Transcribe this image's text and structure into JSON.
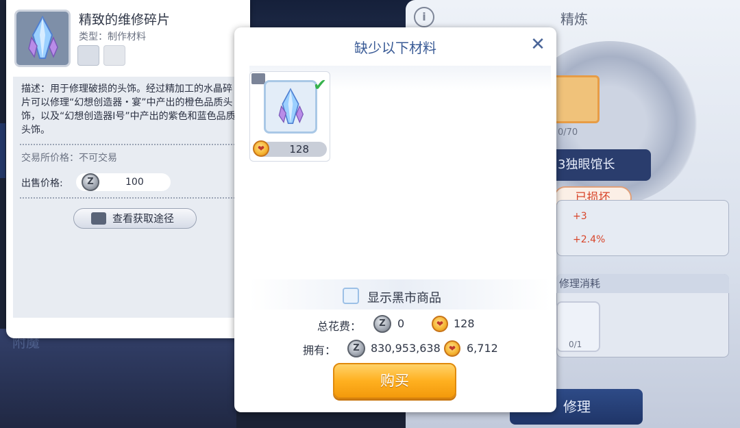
{
  "background": {
    "refine_title": "精炼",
    "info_icon": "info-icon",
    "card_count": "0/70",
    "boss_name": "3独眼馆长",
    "broken_status": "已损坏",
    "stat_line_1": "+3",
    "stat_line_2": "+2.4%",
    "repair_cost_title": "修理消耗",
    "repair_cost_count": "0/1",
    "repair_button": "修理",
    "left_menu_item": "附魔"
  },
  "tooltip": {
    "item_name": "精致的维修碎片",
    "item_type": "类型：制作材料",
    "description": "描述：用于修理破损的头饰。经过精加工的水晶碎片可以修理“幻想创造器・宴”中产出的橙色品质头饰，以及“幻想创造器I号”中产出的紫色和蓝色品质头饰。",
    "trade_price": "交易所价格：不可交易",
    "sell_price_label": "出售价格:",
    "sell_price_value": "100",
    "source_button": "查看获取途径"
  },
  "dialog": {
    "title": "缺少以下材料",
    "close_icon": "close-icon",
    "material": {
      "count": "128",
      "checked": true
    },
    "black_market_label": "显示黑市商品",
    "total_label": "总花费：",
    "total_zeny": "0",
    "total_paw": "128",
    "own_label": "拥有：",
    "own_zeny": "830,953,638",
    "own_paw": "6,712",
    "buy_button": "购买"
  },
  "icons": {
    "zeny_glyph": "Z",
    "paw_glyph": "❤",
    "check_glyph": "✔",
    "close_glyph": "✕"
  },
  "colors": {
    "dialog_title": "#3a5b96",
    "buy_button": "#ffb020",
    "broken_status": "#d8452a"
  }
}
